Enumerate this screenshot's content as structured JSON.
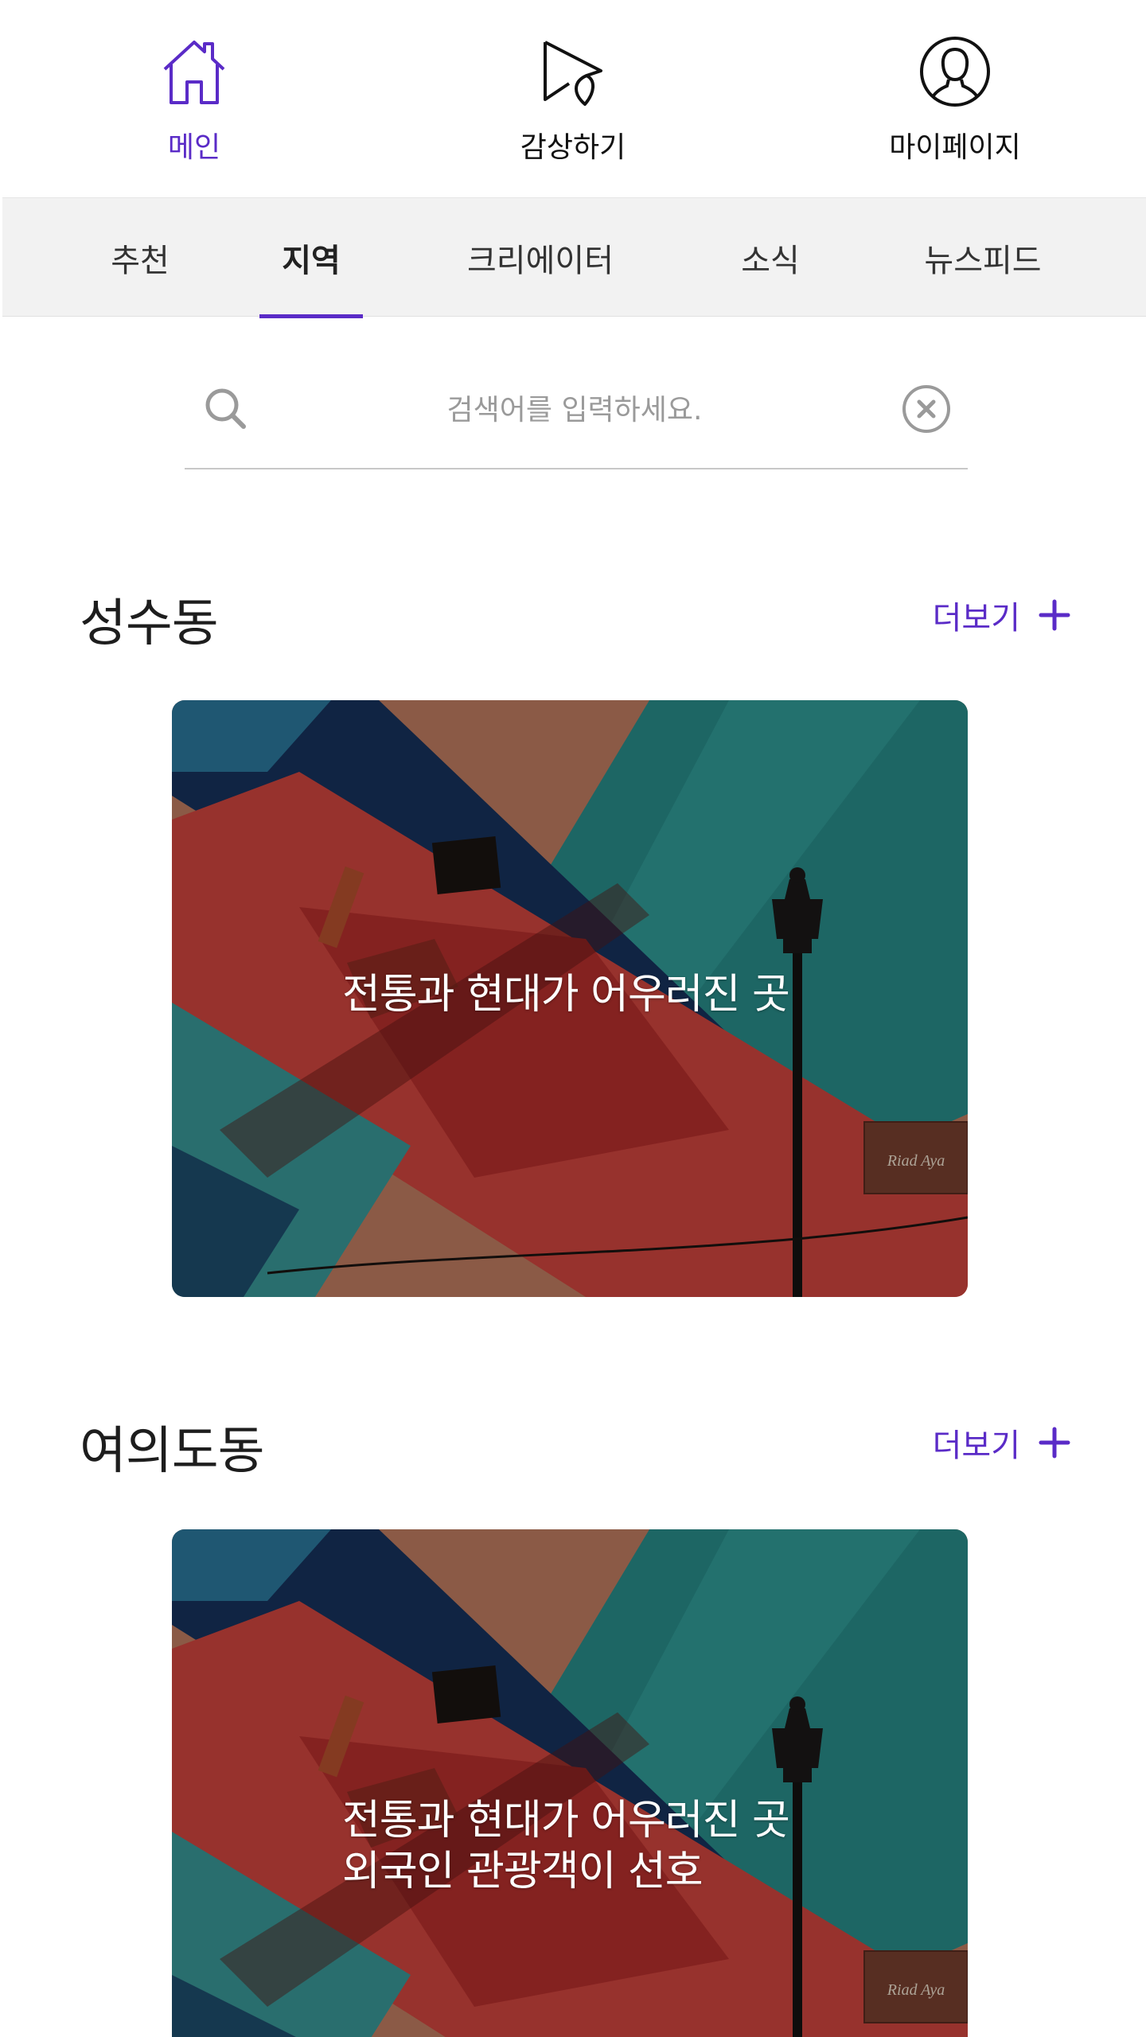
{
  "topnav": {
    "items": [
      {
        "label": "메인",
        "icon": "home-icon",
        "active": true
      },
      {
        "label": "감상하기",
        "icon": "play-pin-icon",
        "active": false
      },
      {
        "label": "마이페이지",
        "icon": "user-icon",
        "active": false
      }
    ],
    "accent": "#5a2bc7"
  },
  "tabs": [
    {
      "label": "추천",
      "active": false
    },
    {
      "label": "지역",
      "active": true
    },
    {
      "label": "크리에이터",
      "active": false
    },
    {
      "label": "소식",
      "active": false
    },
    {
      "label": "뉴스피드",
      "active": false
    }
  ],
  "search": {
    "placeholder": "검색어를 입력하세요.",
    "value": "",
    "search_icon": "search-icon",
    "clear_icon": "clear-circle-icon"
  },
  "sections": [
    {
      "title": "성수동",
      "more_label": "더보기",
      "card": {
        "caption_lines": [
          "전통과 현대가 어우러진 곳"
        ],
        "sign_text": "Riad Aya"
      }
    },
    {
      "title": "여의도동",
      "more_label": "더보기",
      "card": {
        "caption_lines": [
          "전통과 현대가 어우러진 곳",
          "외국인 관광객이 선호"
        ],
        "sign_text": "Riad Aya"
      }
    }
  ]
}
